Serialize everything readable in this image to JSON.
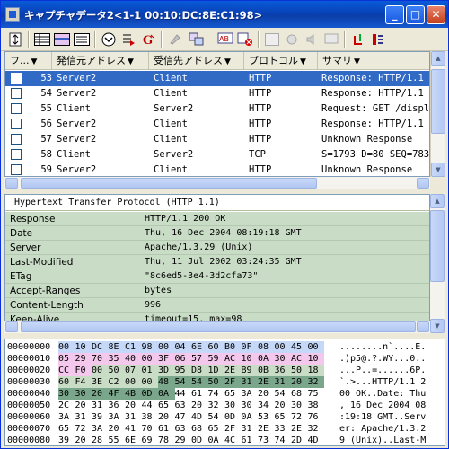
{
  "window": {
    "title": "キャプチャデータ2<1-1 00:10:DC:8E:C1:98>",
    "minimize": "_",
    "maximize": "□",
    "close": "✕"
  },
  "toolbar": {
    "icons": [
      "filter-icon",
      "list-view-icon",
      "split-view-icon",
      "detail-view-icon",
      "down-circle-icon",
      "export-icon",
      "g-icon",
      "paint-icon",
      "copy-icon",
      "ab-icon",
      "delete-icon",
      "table-icon",
      "gear-icon",
      "speaker-icon",
      "display-icon",
      "refresh-icon",
      "report-icon"
    ]
  },
  "packet_list": {
    "columns": [
      "フ...",
      "発信元アドレス",
      "受信先アドレス",
      "プロトコル",
      "サマリ"
    ],
    "rows": [
      {
        "no": "53",
        "src": "Server2",
        "dst": "Client",
        "proto": "HTTP",
        "summary": "Response: HTTP/1.1 20",
        "selected": true
      },
      {
        "no": "54",
        "src": "Server2",
        "dst": "Client",
        "proto": "HTTP",
        "summary": "Response: HTTP/1.1 20",
        "selected": false
      },
      {
        "no": "55",
        "src": "Client",
        "dst": "Server2",
        "proto": "HTTP",
        "summary": "Request: GET /display",
        "selected": false
      },
      {
        "no": "56",
        "src": "Server2",
        "dst": "Client",
        "proto": "HTTP",
        "summary": "Response: HTTP/1.1 20",
        "selected": false
      },
      {
        "no": "57",
        "src": "Server2",
        "dst": "Client",
        "proto": "HTTP",
        "summary": "Unknown Response",
        "selected": false
      },
      {
        "no": "58",
        "src": "Client",
        "dst": "Server2",
        "proto": "TCP",
        "summary": "S=1793 D=80 SEQ=78387",
        "selected": false
      },
      {
        "no": "59",
        "src": "Server2",
        "dst": "Client",
        "proto": "HTTP",
        "summary": "Unknown Response",
        "selected": false
      }
    ]
  },
  "detail": {
    "title": "Hypertext Transfer Protocol (HTTP 1.1)",
    "fields": [
      {
        "k": "Response",
        "v": "HTTP/1.1 200 OK"
      },
      {
        "k": "Date",
        "v": "Thu, 16 Dec 2004 08:19:18 GMT"
      },
      {
        "k": "Server",
        "v": "Apache/1.3.29 (Unix)"
      },
      {
        "k": "Last-Modified",
        "v": "Thu, 11 Jul 2002 03:24:35 GMT"
      },
      {
        "k": "ETag",
        "v": "\"8c6ed5-3e4-3d2cfa73\""
      },
      {
        "k": "Accept-Ranges",
        "v": "bytes"
      },
      {
        "k": "Content-Length",
        "v": "996"
      },
      {
        "k": "Keep-Alive",
        "v": "timeout=15, max=98"
      }
    ]
  },
  "hex": {
    "colors": {
      "blue": "#c6d8f8",
      "pink": "#f4c8ec",
      "green": "#c9dcc6",
      "dark_green": "#7aa68c",
      "selection": "#316ac5"
    },
    "lines": [
      {
        "off": "00000000",
        "bytes": [
          "00",
          "10",
          "DC",
          "8E",
          "C1",
          "98",
          "00",
          "04",
          "6E",
          "60",
          "B0",
          "0F",
          "08",
          "00",
          "45",
          "00"
        ],
        "ascii": "........n`....E."
      },
      {
        "off": "00000010",
        "bytes": [
          "05",
          "29",
          "70",
          "35",
          "40",
          "00",
          "3F",
          "06",
          "57",
          "59",
          "AC",
          "10",
          "0A",
          "30",
          "AC",
          "10"
        ],
        "ascii": ".)p5@.?.WY...0.."
      },
      {
        "off": "00000020",
        "bytes": [
          "CC",
          "F0",
          "00",
          "50",
          "07",
          "01",
          "3D",
          "95",
          "D8",
          "1D",
          "2E",
          "B9",
          "0B",
          "36",
          "50",
          "18"
        ],
        "ascii": "...P..=......6P."
      },
      {
        "off": "00000030",
        "bytes": [
          "60",
          "F4",
          "3E",
          "C2",
          "00",
          "00",
          "48",
          "54",
          "54",
          "50",
          "2F",
          "31",
          "2E",
          "31",
          "20",
          "32"
        ],
        "ascii": "`.>...HTTP/1.1 2"
      },
      {
        "off": "00000040",
        "bytes": [
          "30",
          "30",
          "20",
          "4F",
          "4B",
          "0D",
          "0A",
          "44",
          "61",
          "74",
          "65",
          "3A",
          "20",
          "54",
          "68",
          "75"
        ],
        "ascii": "00 OK..Date: Thu"
      },
      {
        "off": "00000050",
        "bytes": [
          "2C",
          "20",
          "31",
          "36",
          "20",
          "44",
          "65",
          "63",
          "20",
          "32",
          "30",
          "30",
          "34",
          "20",
          "30",
          "38"
        ],
        "ascii": ", 16 Dec 2004 08"
      },
      {
        "off": "00000060",
        "bytes": [
          "3A",
          "31",
          "39",
          "3A",
          "31",
          "38",
          "20",
          "47",
          "4D",
          "54",
          "0D",
          "0A",
          "53",
          "65",
          "72",
          "76"
        ],
        "ascii": ":19:18 GMT..Serv"
      },
      {
        "off": "00000070",
        "bytes": [
          "65",
          "72",
          "3A",
          "20",
          "41",
          "70",
          "61",
          "63",
          "68",
          "65",
          "2F",
          "31",
          "2E",
          "33",
          "2E",
          "32"
        ],
        "ascii": "er: Apache/1.3.2"
      },
      {
        "off": "00000080",
        "bytes": [
          "39",
          "20",
          "28",
          "55",
          "6E",
          "69",
          "78",
          "29",
          "0D",
          "0A",
          "4C",
          "61",
          "73",
          "74",
          "2D",
          "4D"
        ],
        "ascii": "9 (Unix)..Last-M"
      }
    ]
  }
}
